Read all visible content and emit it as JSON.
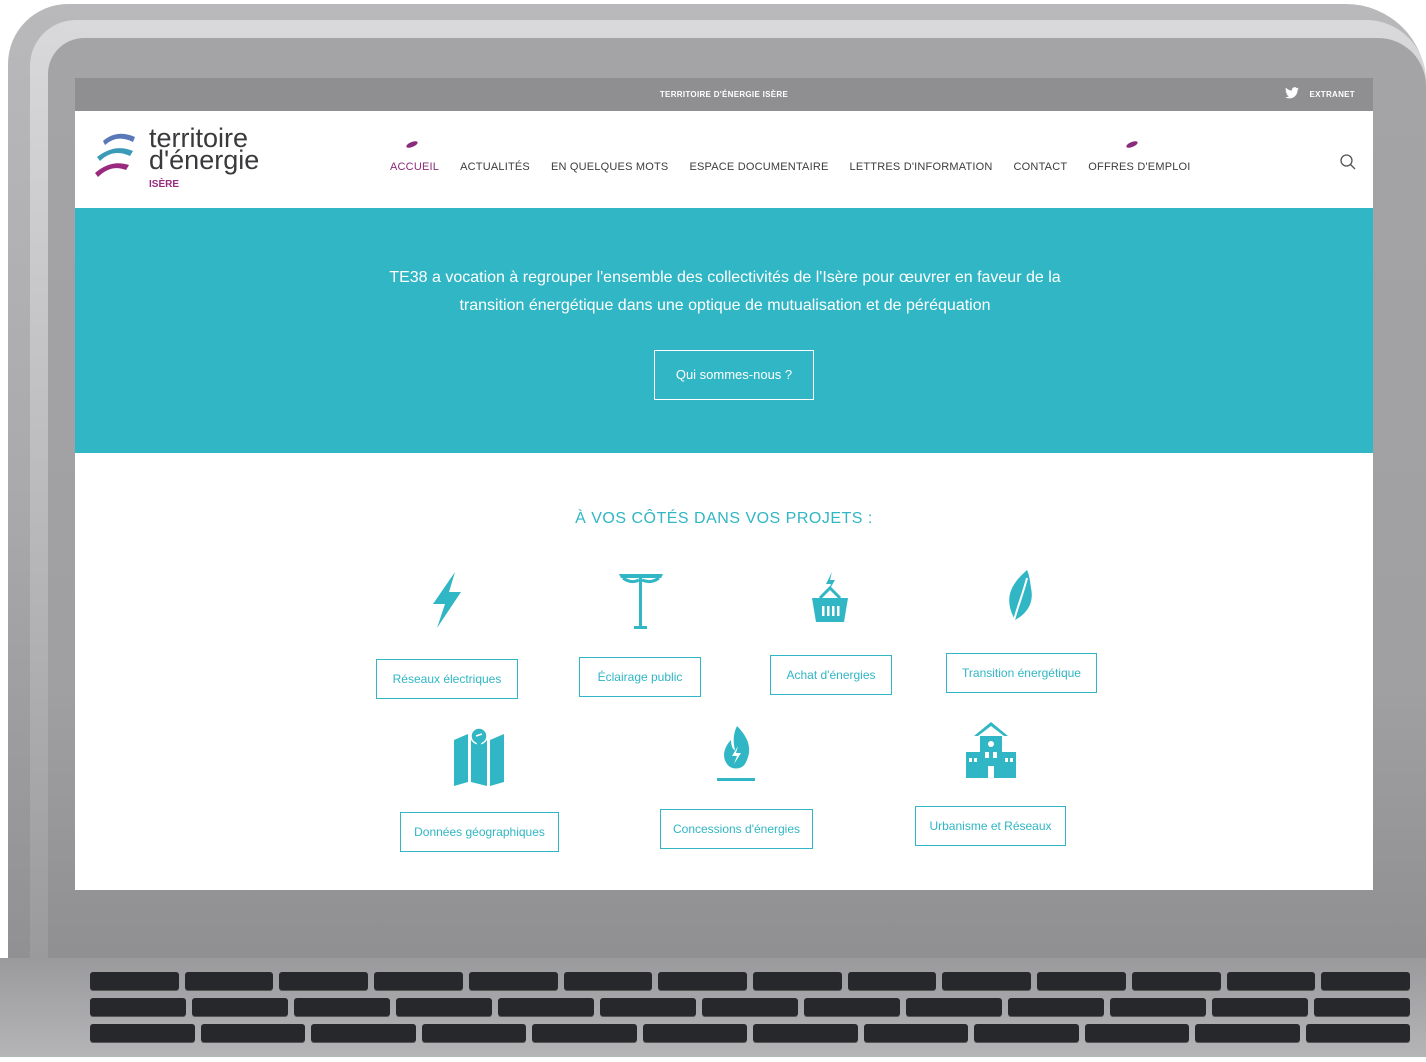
{
  "topbar": {
    "site_title": "TERRITOIRE D'ÉNERGIE ISÈRE",
    "extranet": "EXTRANET"
  },
  "logo": {
    "line1": "territoire",
    "line2": "d'énergie",
    "sub": "ISÈRE"
  },
  "nav": {
    "items": [
      "ACCUEIL",
      "ACTUALITÉS",
      "EN QUELQUES MOTS",
      "ESPACE DOCUMENTAIRE",
      "LETTRES D'INFORMATION",
      "CONTACT",
      "OFFRES D'EMPLOI"
    ]
  },
  "hero": {
    "text": "TE38 a vocation à regrouper l'ensemble des collectivités de l'Isère pour œuvrer en faveur de la transition énergétique dans une optique de mutualisation et de péréquation",
    "button": "Qui sommes-nous ?"
  },
  "services": {
    "title": "À VOS CÔTÉS DANS VOS PROJETS :",
    "items": [
      {
        "label": "Réseaux électriques",
        "icon": "lightning-icon"
      },
      {
        "label": "Éclairage public",
        "icon": "streetlight-icon"
      },
      {
        "label": "Achat d'énergies",
        "icon": "basket-icon"
      },
      {
        "label": "Transition énergétique",
        "icon": "leaf-icon"
      },
      {
        "label": "Données géographiques",
        "icon": "map-icon"
      },
      {
        "label": "Concessions d'énergies",
        "icon": "flame-icon"
      },
      {
        "label": "Urbanisme et Réseaux",
        "icon": "building-icon"
      }
    ]
  },
  "colors": {
    "accent": "#30b6c4",
    "brand": "#8a2a7a",
    "topbar": "#8f8f91"
  }
}
